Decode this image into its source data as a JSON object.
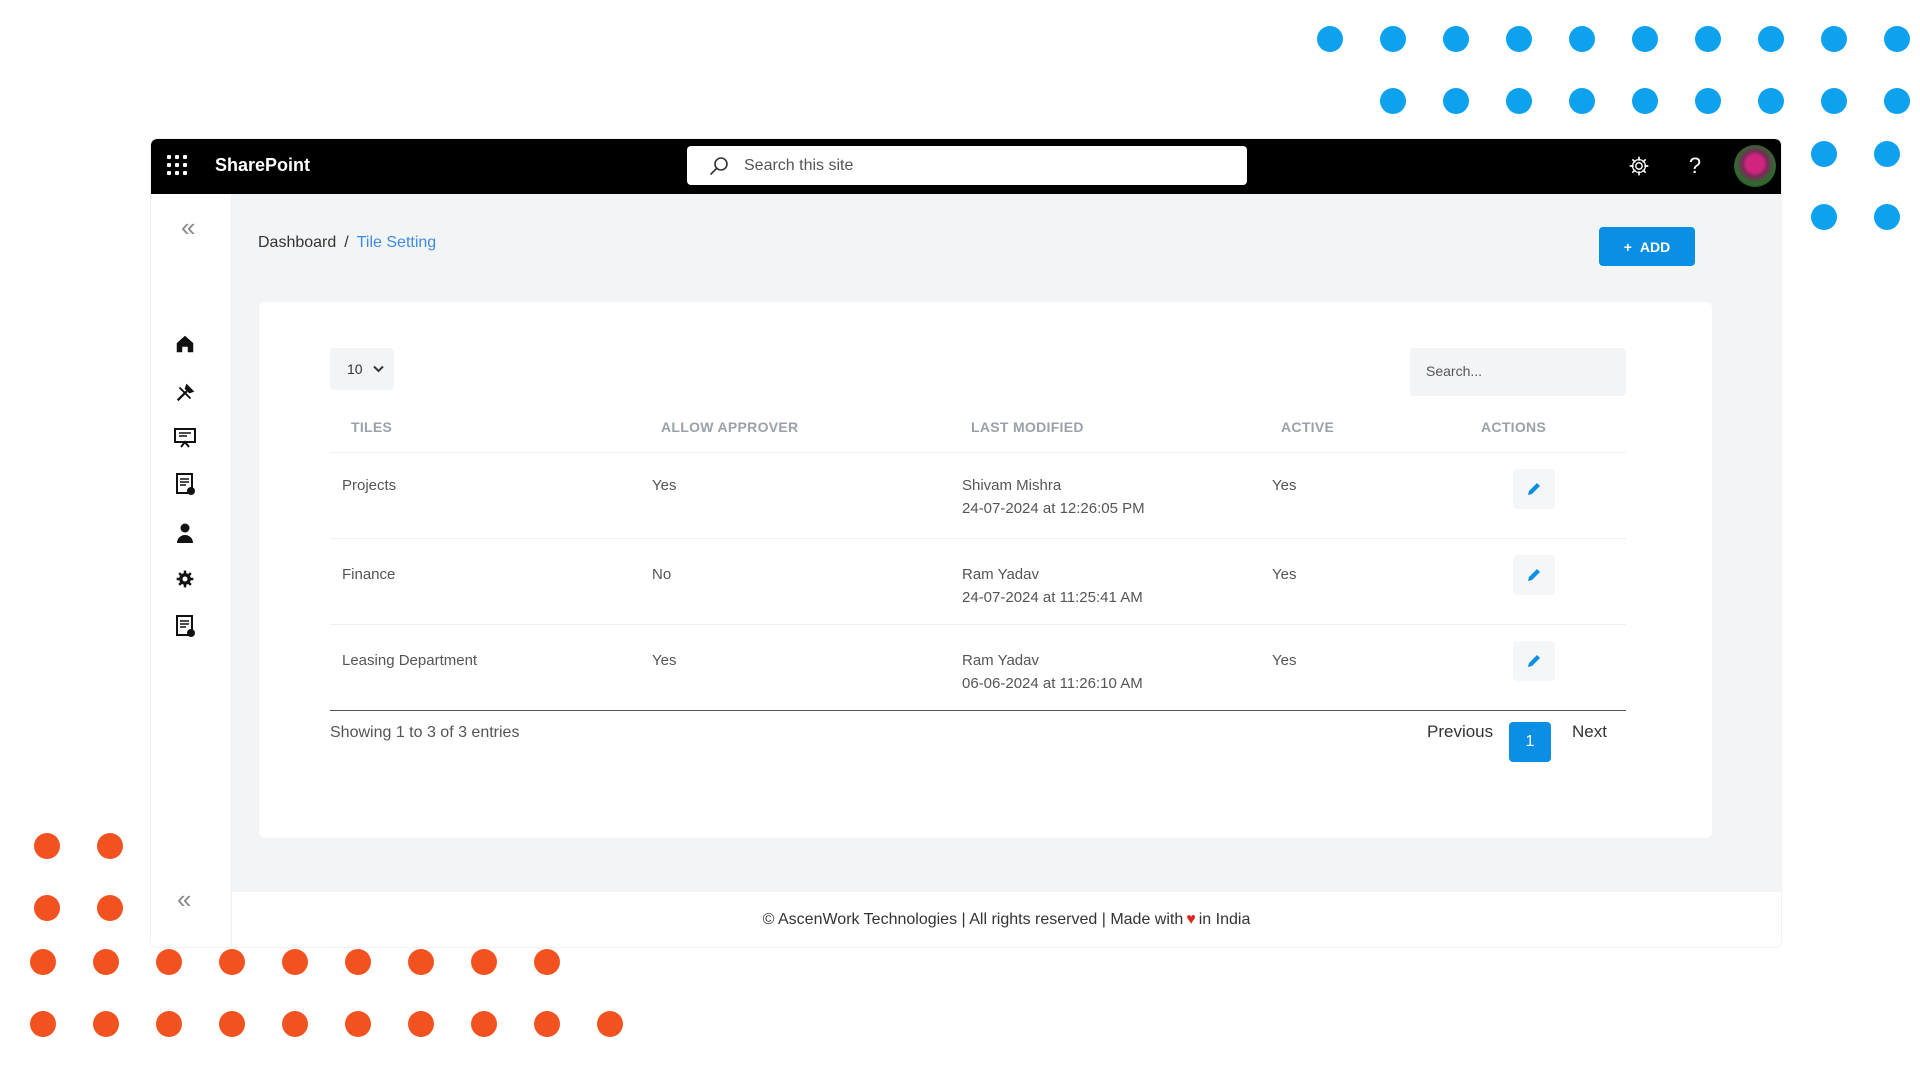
{
  "colors": {
    "accent": "#0a8fe4",
    "dots_blue": "#0ea1ee",
    "dots_orange": "#f2521f",
    "topbar": "#000000"
  },
  "topbar": {
    "app_name": "SharePoint",
    "search_placeholder": "Search this site",
    "icons": [
      "app-launcher-icon",
      "settings-icon",
      "help-icon",
      "user-avatar"
    ]
  },
  "sidebar": {
    "items": [
      "home-icon",
      "tools-icon",
      "presentation-icon",
      "document-icon",
      "user-icon",
      "gear-icon",
      "document-icon"
    ]
  },
  "breadcrumb": {
    "root": "Dashboard",
    "separator": "/",
    "current": "Tile Setting"
  },
  "add_button": {
    "icon": "+",
    "label": "ADD"
  },
  "table": {
    "page_size": "10",
    "search_placeholder": "Search...",
    "headers": [
      "TILES",
      "ALLOW APPROVER",
      "LAST MODIFIED",
      "ACTIVE",
      "ACTIONS"
    ],
    "rows": [
      {
        "tile": "Projects",
        "allow_approver": "Yes",
        "modified_by": "Shivam Mishra",
        "modified_at": "24-07-2024 at 12:26:05 PM",
        "active": "Yes"
      },
      {
        "tile": "Finance",
        "allow_approver": "No",
        "modified_by": "Ram Yadav",
        "modified_at": "24-07-2024 at 11:25:41 AM",
        "active": "Yes"
      },
      {
        "tile": "Leasing Department",
        "allow_approver": "Yes",
        "modified_by": "Ram Yadav",
        "modified_at": "06-06-2024 at 11:26:10 AM",
        "active": "Yes"
      }
    ],
    "info": "Showing 1 to 3 of 3 entries",
    "pagination": {
      "previous": "Previous",
      "current": "1",
      "next": "Next"
    }
  },
  "footer": {
    "before": "© AscenWork Technologies | All rights reserved | Made with",
    "after": "in India"
  }
}
